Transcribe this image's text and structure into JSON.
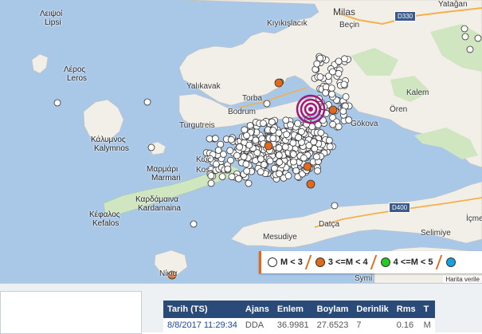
{
  "map": {
    "labels": {
      "lipsi_gr": "Λειψοί",
      "lipsi": "Lipsi",
      "leros_gr": "Λέρος",
      "leros": "Leros",
      "kalymnos_gr": "Κάλυμνος",
      "kalymnos": "Kalymnos",
      "mastichari_gr": "Μαρμάρι",
      "marmari": "Marmari",
      "kardamaina_gr": "Καρδάμαινα",
      "kardamaina": "Kardamaina",
      "kefalos_gr": "Κέφαλος",
      "kefalos": "Kefalos",
      "kos_gr": "Κως",
      "kos": "Kos",
      "nikia_gr": "Νίκια",
      "milas": "Milas",
      "becin": "Beçin",
      "kiyikislacik": "Kıyıkışlacık",
      "yatagan": "Yatağan",
      "yalikavak": "Yalıkavak",
      "torba": "Torba",
      "bodrum": "Bodrum",
      "turgutreis": "Turgutreis",
      "kalem": "Kalem",
      "oren": "Ören",
      "gokova": "Gökova",
      "mesudiye": "Mesudiye",
      "datca": "Datça",
      "selimiye": "Selimiye",
      "icmeler": "İçme",
      "symi": "Symi",
      "road_d330": "D330",
      "road_d400": "D400"
    },
    "attribution": "Harita verile"
  },
  "legend": {
    "items": [
      {
        "label": "M <  3",
        "color": "#ffffff"
      },
      {
        "label": "3 <=M < 4",
        "color": "#e06a1b"
      },
      {
        "label": "4 <=M < 5",
        "color": "#22cc22"
      },
      {
        "label": "",
        "color": "#1aa0e0"
      }
    ]
  },
  "table": {
    "headers": [
      "Tarih (TS)",
      "Ajans",
      "Enlem",
      "Boylam",
      "Derinlik",
      "Rms",
      "T"
    ],
    "rows": [
      [
        "8/8/2017 11:29:34",
        "DDA",
        "36.9981",
        "27.6523",
        "7",
        "0.16",
        "M"
      ]
    ]
  },
  "colors": {
    "sea": "#a9c8e8",
    "land": "#f2efe9",
    "forest": "#cfe6c0",
    "epicenter": "#a0187a",
    "table_header": "#2a4a7a"
  }
}
